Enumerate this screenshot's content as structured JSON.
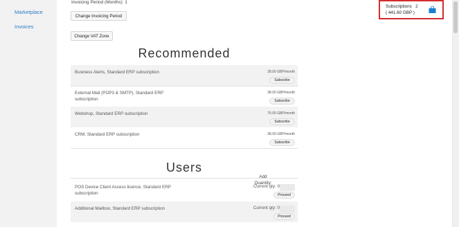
{
  "sidebar": {
    "items": [
      {
        "label": "Marketplace"
      },
      {
        "label": "Invoices"
      }
    ]
  },
  "settings": {
    "invoicing_period_label": "Invoicing Period (Months): 1",
    "change_invoicing_button": "Change Invoicing Period",
    "change_vat_button": "Change VAT Zone"
  },
  "cart": {
    "label": "Subscriptions",
    "count": "2",
    "total": "( 441.60 GBP )",
    "icon": "shopping-bag-icon",
    "border_color": "#d42b2b",
    "icon_color": "#1c7fcf"
  },
  "recommended": {
    "title": "Recommended",
    "items": [
      {
        "name": "Business Alerts, Standard ERP subscription",
        "price": "28.00 GBP/month",
        "button": "Subscribe"
      },
      {
        "name": "External Mail (POP3 & SMTP), Standard ERP subscription",
        "price": "38.00 GBP/month",
        "button": "Subscribe"
      },
      {
        "name": "Webshop, Standard ERP subscription",
        "price": "75.00 GBP/month",
        "button": "Subscribe"
      },
      {
        "name": "CRM, Standard ERP subscription",
        "price": "38.00 GBP/month",
        "button": "Subscribe"
      }
    ]
  },
  "users": {
    "title": "Users",
    "add_quantity_label": "Add Quantity:",
    "items": [
      {
        "name": "POS Device Client Access licence, Standard ERP subscription",
        "qty_label": "Current qty: 0",
        "button": "Proceed"
      },
      {
        "name": "Additional Mailbox, Standard ERP subscription",
        "qty_label": "Current qty: 0",
        "button": "Proceed"
      }
    ]
  }
}
